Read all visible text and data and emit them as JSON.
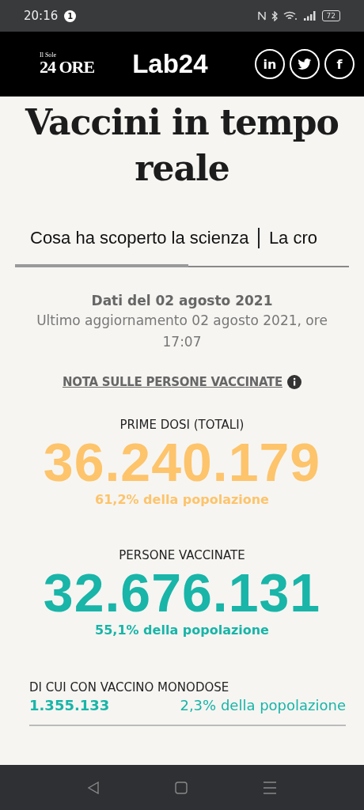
{
  "status_bar": {
    "time": "20:16",
    "notification_count": "1",
    "battery": "72"
  },
  "header": {
    "brand_small": "Il Sole",
    "brand": "24 ORE",
    "lab_logo": "Lab24",
    "social": [
      {
        "kind": "linkedin",
        "label": "in"
      },
      {
        "kind": "twitter"
      },
      {
        "kind": "facebook",
        "label": "f"
      }
    ]
  },
  "title": "Vaccini in tempo reale",
  "tabs": [
    {
      "label": "Cosa ha scoperto la scienza"
    },
    {
      "label": "La cro"
    }
  ],
  "data_date": "Dati del 02 agosto 2021",
  "last_update": "Ultimo aggiornamento 02 agosto 2021, ore 17:07",
  "note_link": "NOTA SULLE PERSONE VACCINATE",
  "stats": [
    {
      "label": "PRIME DOSI (TOTALI)",
      "value": "36.240.179",
      "share": "61,2% della popolazione",
      "color": "#fdc46b"
    },
    {
      "label": "PERSONE VACCINATE",
      "value": "32.676.131",
      "share": "55,1% della popolazione",
      "color": "#18b5a8"
    }
  ],
  "single_dose": {
    "label": "DI CUI CON VACCINO MONODOSE",
    "value": "1.355.133",
    "share": "2,3% della popolazione"
  }
}
